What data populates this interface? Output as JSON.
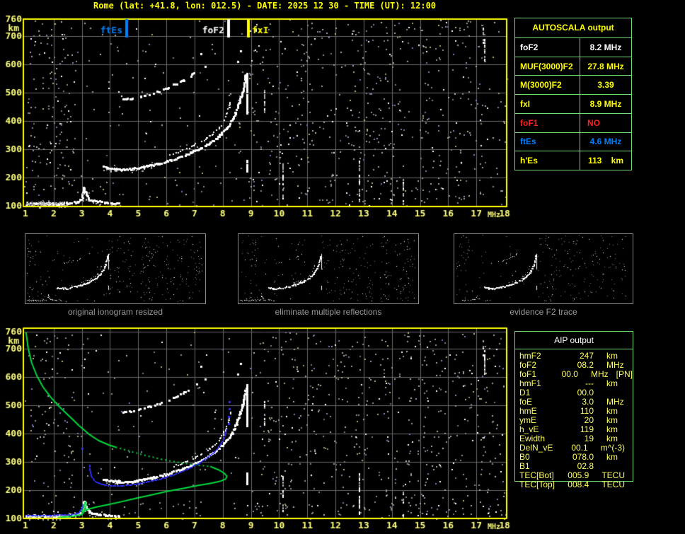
{
  "title": "Rome (lat: +41.8, lon: 012.5) - DATE: 2025 12 30 - TIME (UT): 12:00",
  "colors": {
    "background": "#000000",
    "title_yellow": "#FFFF00",
    "axis_label": "#FFFF7E",
    "plot_border": "#FFFF00",
    "grid": "#6B6B6B",
    "table_border_green": "#74DB74",
    "profile_green": "#00D93C",
    "restored_trace_blue": "#2E2EFF",
    "marker_blue": "#0080FF",
    "marker_white": "#FFFFFF",
    "marker_yellow": "#FFFF00",
    "red": "#FF2020",
    "aip_text": "#FFFF5E",
    "caption_gray": "#9A9A9A"
  },
  "autoscala": {
    "header": "AUTOSCALA output",
    "rows": [
      {
        "label": "foF2",
        "value": "8.2 MHz",
        "color": "white"
      },
      {
        "label": "MUF(3000)F2",
        "value": "27.8 MHz",
        "color": "yellow"
      },
      {
        "label": "M(3000)F2",
        "value": "3.39",
        "color": "yellow"
      },
      {
        "label": "fxI",
        "value": "8.9 MHz",
        "color": "yellow"
      },
      {
        "label": "foF1",
        "value": "NO",
        "color": "red"
      },
      {
        "label": "ftEs",
        "value": "4.6 MHz",
        "color": "blue"
      },
      {
        "label": "h'Es",
        "value": "113    km",
        "color": "yellow"
      }
    ]
  },
  "aip": {
    "header": "AIP output",
    "rows": [
      {
        "label": "hmF2",
        "value": "247",
        "unit": "km",
        "extra": ""
      },
      {
        "label": "foF2",
        "value": "08.2",
        "unit": "MHz",
        "extra": ""
      },
      {
        "label": "foF1",
        "value": "00.0",
        "unit": "MHz",
        "extra": "[PN]"
      },
      {
        "label": "hmF1",
        "value": "---",
        "unit": "km",
        "extra": ""
      },
      {
        "label": "D1",
        "value": "00.0",
        "unit": "",
        "extra": ""
      },
      {
        "label": "foE",
        "value": "3.0",
        "unit": "MHz",
        "extra": ""
      },
      {
        "label": "hmE",
        "value": "110",
        "unit": "km",
        "extra": ""
      },
      {
        "label": "ymE",
        "value": "20",
        "unit": "km",
        "extra": ""
      },
      {
        "label": "h_vE",
        "value": "119",
        "unit": "km",
        "extra": ""
      },
      {
        "label": "Ewidth",
        "value": "19",
        "unit": "km",
        "extra": ""
      },
      {
        "label": "DelN_vE",
        "value": "00.1",
        "unit": "m^(-3)",
        "extra": ""
      },
      {
        "label": "B0",
        "value": "078.0",
        "unit": "km",
        "extra": ""
      },
      {
        "label": "B1",
        "value": "02.8",
        "unit": "",
        "extra": ""
      },
      {
        "label": "TEC[Bot]",
        "value": "005.9",
        "unit": "TECU",
        "extra": ""
      },
      {
        "label": "TEC[Top]",
        "value": "008.4",
        "unit": "TECU",
        "extra": ""
      }
    ]
  },
  "thumbnails": [
    {
      "caption": "original ionogram resized"
    },
    {
      "caption": "eliminate multiple reflections"
    },
    {
      "caption": "evidence F2 trace"
    }
  ],
  "chart_data": {
    "type": "heatmap",
    "description": "ionogram pair: scaled ionogram (top) and inverted profile overlay (bottom)",
    "x_axis": {
      "label": "MHz",
      "range": [
        1,
        18
      ],
      "ticks": [
        1,
        2,
        3,
        4,
        5,
        6,
        7,
        8,
        9,
        10,
        11,
        12,
        13,
        14,
        15,
        16,
        17,
        18
      ]
    },
    "y_axis": {
      "label": "km",
      "range": [
        100,
        760
      ],
      "ticks": [
        760,
        700,
        600,
        500,
        400,
        300,
        200,
        100
      ]
    },
    "grid": "on",
    "markers": [
      {
        "label": "ftEs",
        "freq": 4.6,
        "color": "#0080FF",
        "side": "left"
      },
      {
        "label": "foF2",
        "freq": 8.2,
        "color": "#FFFFFF",
        "side": "left"
      },
      {
        "label": "fxI",
        "freq": 8.9,
        "color": "#FFFF00",
        "side": "right"
      }
    ],
    "echo_traces": {
      "es_layer": [
        [
          1.0,
          112
        ],
        [
          1.4,
          110
        ],
        [
          1.8,
          110
        ],
        [
          2.2,
          111
        ],
        [
          2.6,
          113
        ],
        [
          2.85,
          117
        ],
        [
          3.0,
          130
        ],
        [
          3.05,
          168
        ],
        [
          3.12,
          148
        ],
        [
          3.25,
          124
        ],
        [
          3.5,
          118
        ],
        [
          3.8,
          114
        ],
        [
          4.1,
          112
        ],
        [
          4.35,
          111
        ]
      ],
      "f_trace_x": [
        [
          3.75,
          242
        ],
        [
          3.95,
          236
        ],
        [
          4.2,
          232
        ],
        [
          4.5,
          231
        ],
        [
          4.8,
          234
        ],
        [
          5.1,
          239
        ],
        [
          5.45,
          246
        ],
        [
          5.8,
          254
        ],
        [
          6.15,
          264
        ],
        [
          6.5,
          276
        ],
        [
          6.85,
          290
        ],
        [
          7.2,
          307
        ],
        [
          7.55,
          327
        ],
        [
          7.85,
          350
        ],
        [
          8.1,
          376
        ],
        [
          8.3,
          405
        ],
        [
          8.45,
          435
        ],
        [
          8.58,
          470
        ],
        [
          8.68,
          505
        ],
        [
          8.75,
          540
        ],
        [
          8.8,
          565
        ]
      ],
      "f_trace_o": [
        [
          6.1,
          283
        ],
        [
          6.5,
          296
        ],
        [
          6.9,
          312
        ],
        [
          7.25,
          330
        ],
        [
          7.55,
          350
        ],
        [
          7.8,
          372
        ],
        [
          8.0,
          398
        ],
        [
          8.13,
          428
        ],
        [
          8.22,
          458
        ],
        [
          8.27,
          482
        ]
      ],
      "second_hop": [
        [
          4.45,
          478
        ],
        [
          4.75,
          483
        ],
        [
          5.05,
          489
        ],
        [
          5.35,
          497
        ],
        [
          5.65,
          506
        ],
        [
          5.95,
          517
        ],
        [
          6.25,
          530
        ],
        [
          6.55,
          545
        ],
        [
          6.85,
          562
        ],
        [
          7.05,
          578
        ]
      ],
      "hop_dots": [
        [
          7.2,
          640
        ],
        [
          7.35,
          594
        ],
        [
          8.5,
          612
        ],
        [
          8.62,
          650
        ]
      ],
      "x_streaks": [
        [
          8.87,
          430,
          575
        ],
        [
          8.85,
          224,
          266
        ]
      ],
      "noise_streaks": [
        [
          10.15,
          130,
          255
        ],
        [
          12.85,
          120,
          265
        ],
        [
          14.4,
          105,
          200
        ],
        [
          17.3,
          615,
          700
        ],
        [
          9.5,
          430,
          520
        ],
        [
          17.25,
          680,
          735
        ]
      ]
    },
    "profile_green": {
      "topside_solid": [
        [
          1.02,
          758
        ],
        [
          1.1,
          700
        ],
        [
          1.22,
          650
        ],
        [
          1.4,
          605
        ],
        [
          1.62,
          565
        ],
        [
          1.9,
          528
        ],
        [
          2.2,
          495
        ],
        [
          2.55,
          462
        ],
        [
          2.9,
          428
        ],
        [
          3.25,
          398
        ],
        [
          3.6,
          375
        ],
        [
          3.95,
          360
        ],
        [
          4.2,
          352
        ]
      ],
      "valley_dotted": [
        [
          4.2,
          352
        ],
        [
          4.7,
          338
        ],
        [
          5.2,
          324
        ],
        [
          5.7,
          312
        ],
        [
          6.2,
          302
        ],
        [
          6.7,
          294
        ],
        [
          7.15,
          288
        ],
        [
          7.55,
          284
        ]
      ],
      "bottomside_solid": [
        [
          7.55,
          284
        ],
        [
          7.85,
          272
        ],
        [
          8.05,
          260
        ],
        [
          8.15,
          249
        ],
        [
          8.1,
          239
        ],
        [
          7.9,
          231
        ],
        [
          7.55,
          224
        ],
        [
          7.1,
          216
        ],
        [
          6.6,
          206
        ],
        [
          6.05,
          196
        ],
        [
          5.5,
          184
        ],
        [
          4.95,
          172
        ],
        [
          4.4,
          159
        ],
        [
          3.9,
          148
        ],
        [
          3.5,
          140
        ],
        [
          3.2,
          132
        ],
        [
          3.0,
          124
        ],
        [
          3.06,
          140
        ],
        [
          3.12,
          158
        ],
        [
          3.16,
          150
        ],
        [
          3.1,
          126
        ],
        [
          3.0,
          114
        ],
        [
          2.7,
          108
        ],
        [
          2.4,
          105
        ],
        [
          2.15,
          103
        ]
      ]
    },
    "restored_trace_blue": {
      "e_flat": [
        [
          1.0,
          109
        ],
        [
          1.25,
          109
        ],
        [
          1.5,
          110
        ],
        [
          1.75,
          110
        ],
        [
          2.0,
          111
        ],
        [
          2.25,
          112
        ],
        [
          2.5,
          113
        ],
        [
          2.75,
          114
        ],
        [
          2.9,
          120
        ],
        [
          3.0,
          135
        ],
        [
          3.06,
          150
        ]
      ],
      "f_main": [
        [
          3.28,
          288
        ],
        [
          3.3,
          266
        ],
        [
          3.34,
          250
        ],
        [
          3.4,
          239
        ],
        [
          3.48,
          230
        ],
        [
          3.6,
          224
        ],
        [
          3.75,
          219
        ],
        [
          3.95,
          216
        ],
        [
          4.2,
          215
        ],
        [
          4.5,
          216
        ],
        [
          4.8,
          219
        ],
        [
          5.1,
          224
        ],
        [
          5.4,
          230
        ],
        [
          5.7,
          237
        ],
        [
          6.0,
          245
        ],
        [
          6.3,
          255
        ],
        [
          6.6,
          267
        ],
        [
          6.9,
          281
        ],
        [
          7.2,
          297
        ],
        [
          7.45,
          314
        ],
        [
          7.7,
          334
        ],
        [
          7.9,
          357
        ],
        [
          8.03,
          380
        ],
        [
          8.1,
          400
        ],
        [
          8.14,
          415
        ]
      ],
      "dots": [
        [
          8.2,
          435
        ],
        [
          8.21,
          460
        ],
        [
          8.22,
          487
        ],
        [
          8.23,
          512
        ],
        [
          3.0,
          348
        ]
      ]
    }
  }
}
